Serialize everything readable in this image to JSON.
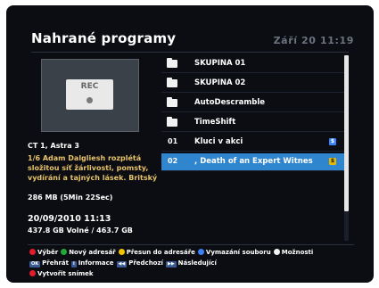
{
  "header": {
    "title": "Nahrané programy",
    "clock": "Září 20 11:19"
  },
  "preview": {
    "rec_label": "REC"
  },
  "details": {
    "channel": "CT 1, Astra 3",
    "description_lines": [
      "1/6 Adam Dalgliesh rozplétá",
      "složitou síť žárlivosti, pomsty,",
      "vydírání a tajných lásek. Britský"
    ],
    "size": "286 MB (5Min 22Sec)",
    "datetime": "20/09/2010 11:13",
    "storage": "437.8 GB Volné / 463.7 GB"
  },
  "list": {
    "items": [
      {
        "type": "folder",
        "num": "",
        "name": "SKUPINA 01",
        "badge": ""
      },
      {
        "type": "folder",
        "num": "",
        "name": "SKUPINA 02",
        "badge": ""
      },
      {
        "type": "folder",
        "num": "",
        "name": "AutoDescramble",
        "badge": ""
      },
      {
        "type": "folder",
        "num": "",
        "name": "TimeShift",
        "badge": ""
      },
      {
        "type": "file",
        "num": "01",
        "name": "Kluci v akci",
        "badge": "$"
      },
      {
        "type": "file",
        "num": "02",
        "name": ", Death of an Expert Witnes",
        "badge": "$",
        "selected": true
      }
    ],
    "scroll_position": 0.84
  },
  "footer": {
    "row1": [
      {
        "color": "#e11d2b",
        "label": "Výběr"
      },
      {
        "color": "#22a83a",
        "label": "Nový adresář"
      },
      {
        "color": "#f2c400",
        "label": "Přesun do adresáře"
      },
      {
        "color": "#3b82f6",
        "label": "Vymazání souboru"
      },
      {
        "color": "#f2f2f2",
        "label": "Možnosti"
      }
    ],
    "row2": [
      {
        "key": "OK",
        "label": "Přehrát"
      },
      {
        "key": "i",
        "label": "Informace"
      },
      {
        "key": "◀◀",
        "label": "Předchozí"
      },
      {
        "key": "▶▶",
        "label": "Následující"
      }
    ],
    "row3": [
      {
        "color": "#e11d2b",
        "label": "Vytvořit snímek"
      }
    ]
  }
}
